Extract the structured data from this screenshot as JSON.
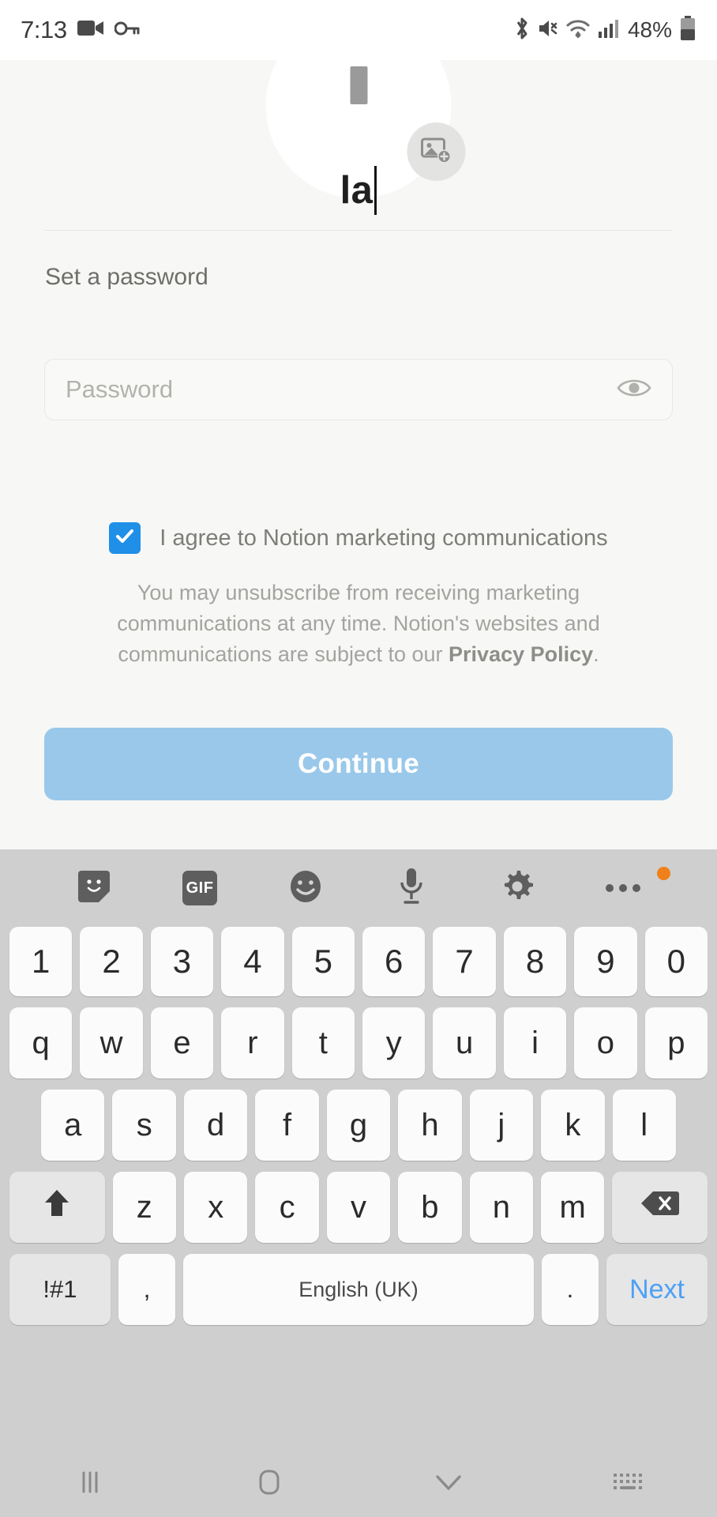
{
  "status_bar": {
    "time": "7:13",
    "battery_percent": "48%",
    "left_icons": [
      "video-camera-icon",
      "key-icon"
    ],
    "right_icons": [
      "bluetooth-icon",
      "mute-icon",
      "wifi-icon",
      "signal-icon"
    ]
  },
  "signup": {
    "avatar_badge_icon": "add-photo-icon",
    "name_value": "la",
    "password_section_label": "Set a password",
    "password_placeholder": "Password",
    "password_toggle_icon": "eye-icon",
    "marketing_checkbox_label": "I agree to Notion marketing communications",
    "marketing_checkbox_checked": true,
    "disclaimer_part1": "You may unsubscribe from receiving marketing communications at any time. Notion's websites and communications are subject to our ",
    "disclaimer_link": "Privacy Policy",
    "disclaimer_part2": ".",
    "continue_label": "Continue",
    "accent_checkbox_color": "#1f8fe8",
    "continue_button_color": "#9ac8ea"
  },
  "keyboard": {
    "toolbar": [
      {
        "name": "sticker-icon",
        "label": ""
      },
      {
        "name": "gif-icon",
        "label": "GIF"
      },
      {
        "name": "emoji-icon",
        "label": ""
      },
      {
        "name": "microphone-icon",
        "label": ""
      },
      {
        "name": "gear-icon",
        "label": ""
      },
      {
        "name": "more-options-icon",
        "label": ""
      }
    ],
    "row_numbers": [
      "1",
      "2",
      "3",
      "4",
      "5",
      "6",
      "7",
      "8",
      "9",
      "0"
    ],
    "row_top": [
      "q",
      "w",
      "e",
      "r",
      "t",
      "y",
      "u",
      "i",
      "o",
      "p"
    ],
    "row_home": [
      "a",
      "s",
      "d",
      "f",
      "g",
      "h",
      "j",
      "k",
      "l"
    ],
    "row_bottom": [
      "z",
      "x",
      "c",
      "v",
      "b",
      "n",
      "m"
    ],
    "shift_icon": "shift-arrow-icon",
    "backspace_icon": "backspace-icon",
    "symbols_label": "!#1",
    "comma_label": ",",
    "space_label": "English (UK)",
    "period_label": ".",
    "next_label": "Next",
    "next_color": "#4da0f5"
  },
  "nav_bar": {
    "recents_icon": "recents-icon",
    "home_icon": "home-icon",
    "back_icon": "chevron-down-icon",
    "hide_keyboard_icon": "keyboard-icon"
  }
}
